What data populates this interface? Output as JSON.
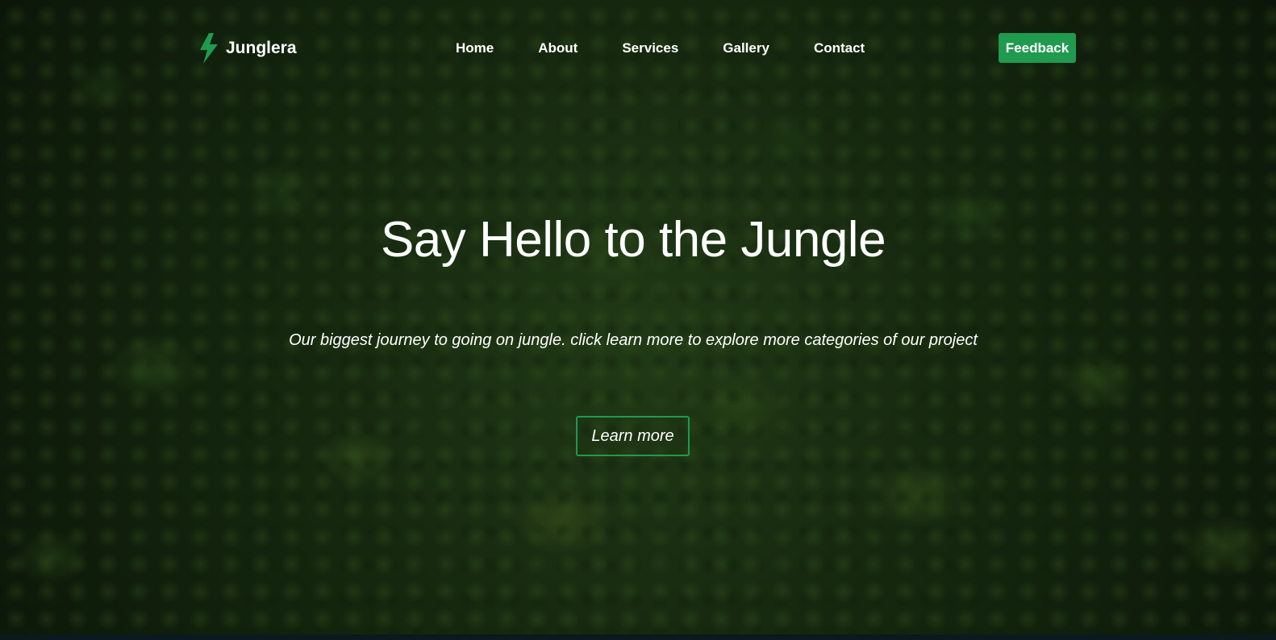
{
  "colors": {
    "accent": "#1f9a4f",
    "text": "#ffffff"
  },
  "brand": {
    "name": "Junglera",
    "icon": "lightning-bolt-icon"
  },
  "nav": {
    "items": [
      {
        "label": "Home"
      },
      {
        "label": "About"
      },
      {
        "label": "Services"
      },
      {
        "label": "Gallery"
      },
      {
        "label": "Contact"
      }
    ],
    "feedback_label": "Feedback"
  },
  "hero": {
    "title": "Say Hello to the Jungle",
    "subtitle": "Our biggest journey to going on jungle. click learn more to explore more categories of our project",
    "cta_label": "Learn more"
  }
}
